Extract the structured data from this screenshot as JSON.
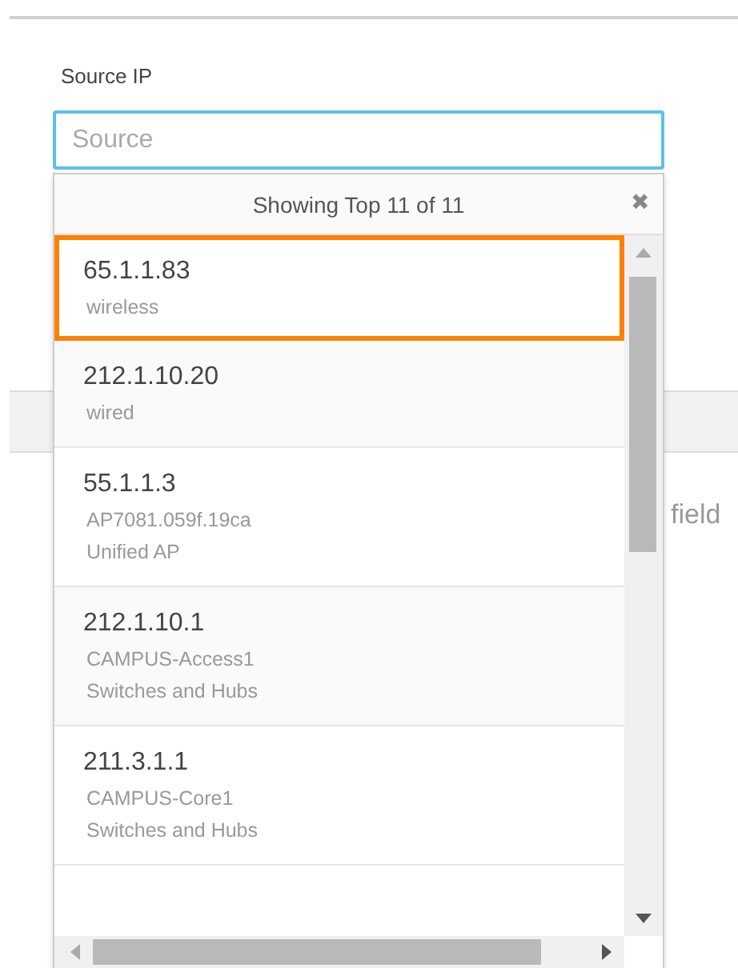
{
  "field": {
    "label": "Source IP",
    "placeholder": "Source",
    "focused": true
  },
  "background": {
    "text": "field"
  },
  "dropdown": {
    "header": "Showing Top 11 of 11",
    "close": "✖",
    "items": [
      {
        "address": "65.1.1.83",
        "lines": [
          "wireless"
        ],
        "selected": true
      },
      {
        "address": "212.1.10.20",
        "lines": [
          "wired"
        ],
        "selected": false
      },
      {
        "address": "55.1.1.3",
        "lines": [
          "AP7081.059f.19ca",
          "Unified AP"
        ],
        "selected": false
      },
      {
        "address": "212.1.10.1",
        "lines": [
          "CAMPUS-Access1",
          "Switches and Hubs"
        ],
        "selected": false
      },
      {
        "address": "211.3.1.1",
        "lines": [
          "CAMPUS-Core1",
          "Switches and Hubs"
        ],
        "selected": false
      }
    ]
  }
}
